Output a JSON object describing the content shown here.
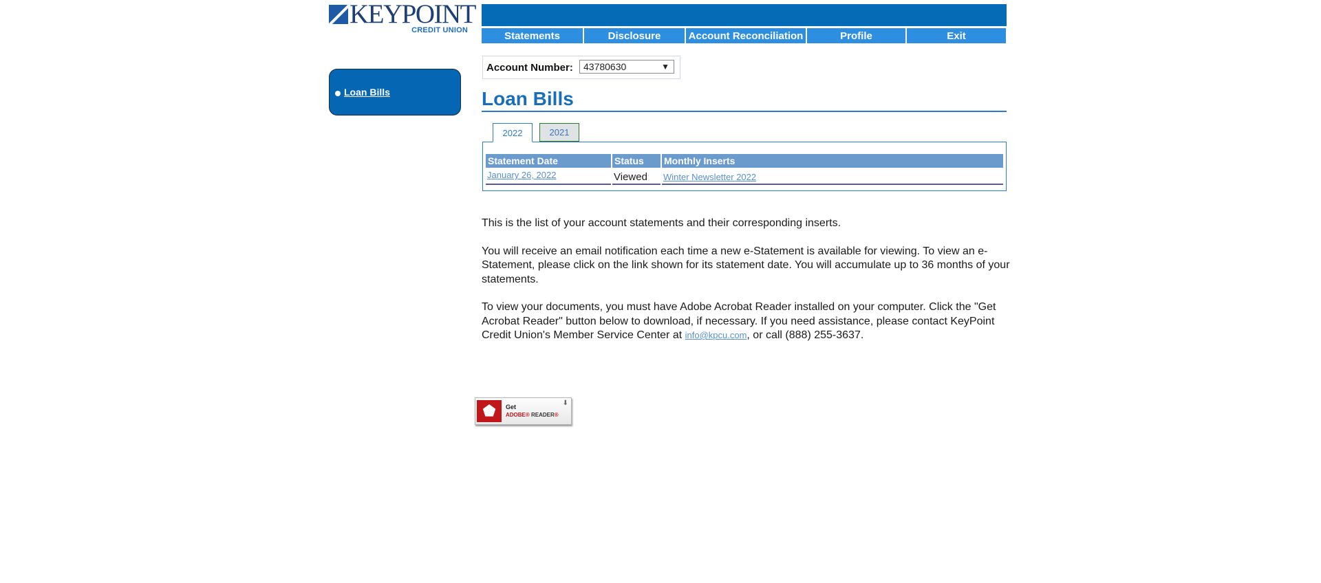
{
  "brand": {
    "name": "KEYPOINT",
    "subtitle": "CREDIT UNION"
  },
  "nav": [
    {
      "label": "Statements"
    },
    {
      "label": "Disclosure"
    },
    {
      "label": "Account Reconciliation"
    },
    {
      "label": "Profile"
    },
    {
      "label": "Exit"
    }
  ],
  "sidebar": {
    "items": [
      {
        "label": "Loan Bills"
      }
    ]
  },
  "account": {
    "label": "Account Number:",
    "selected": "43780630"
  },
  "page": {
    "title": "Loan Bills"
  },
  "tabs": [
    {
      "label": "2022",
      "active": true
    },
    {
      "label": "2021",
      "active": false
    }
  ],
  "table": {
    "headers": [
      "Statement Date",
      "Status",
      "Monthly Inserts"
    ],
    "rows": [
      {
        "date": "January 26, 2022",
        "status": "Viewed",
        "insert": "Winter Newsletter 2022"
      }
    ]
  },
  "info": {
    "p1": "This is the list of your account statements and their corresponding inserts.",
    "p2": "You will receive an email notification each time a new e-Statement is available for viewing. To view an e-Statement, please click on the link shown for its statement date. You will accumulate up to 36 months of your statements.",
    "p3_before": "To view your documents, you must have Adobe Acrobat Reader installed on your computer. Click the \"Get Acrobat Reader\" button below to download, if necessary. If you need assistance, please contact KeyPoint Credit Union's Member Service Center at ",
    "p3_email": "info@kpcu.com",
    "p3_after": ", or call (888) 255-3637."
  },
  "adobe": {
    "get": "Get",
    "brand": "ADOBE",
    "reader": "READER"
  },
  "colors": {
    "primary": "#056bb6",
    "nav": "#2e8fe0",
    "header_cell": "#6a9bcc",
    "link": "#5a8fcf"
  }
}
